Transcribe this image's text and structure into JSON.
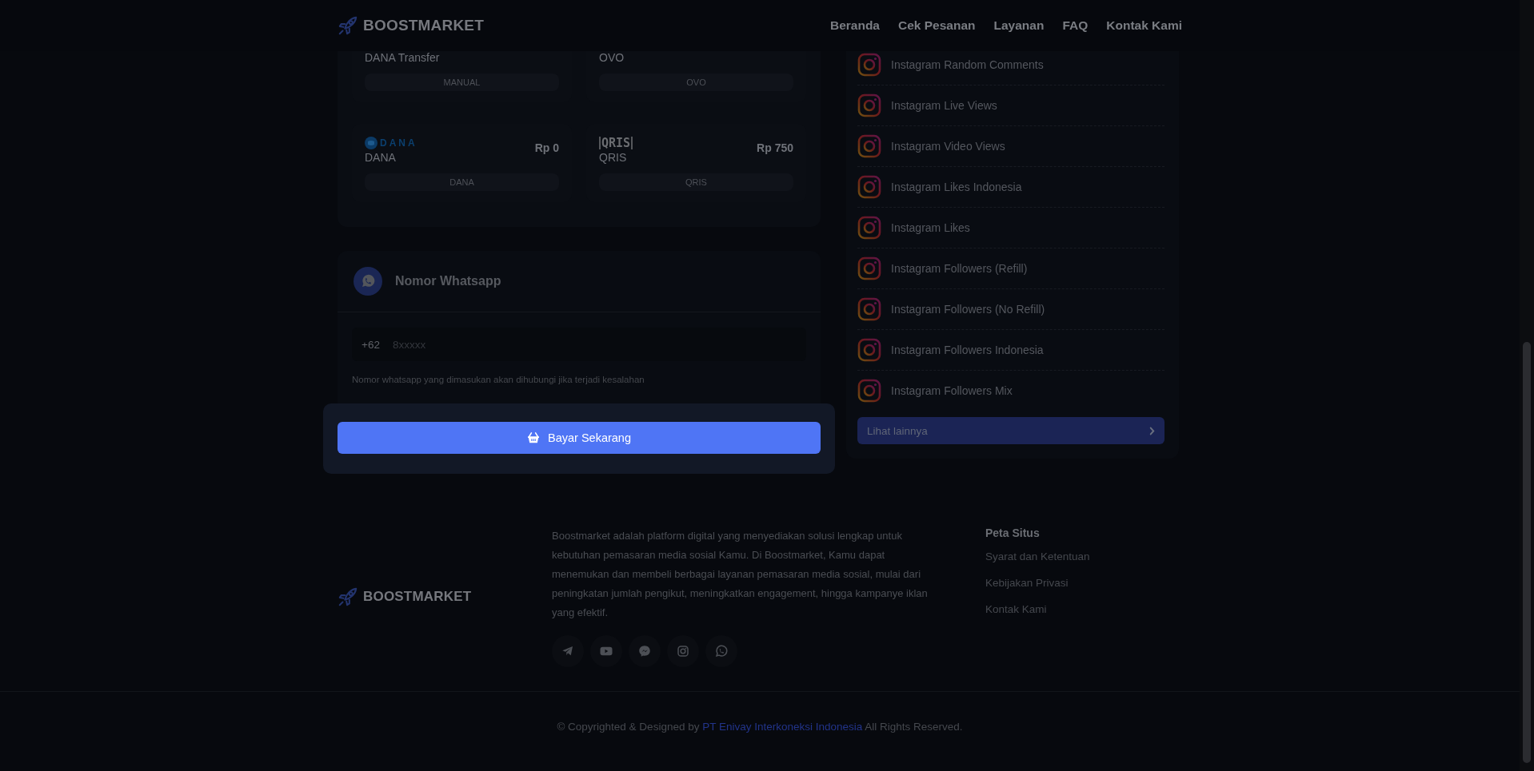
{
  "header": {
    "brand": "BOOSTMARKET",
    "nav": [
      {
        "label": "Beranda"
      },
      {
        "label": "Cek Pesanan"
      },
      {
        "label": "Layanan"
      },
      {
        "label": "FAQ"
      },
      {
        "label": "Kontak Kami"
      }
    ]
  },
  "payment_methods": [
    {
      "name": "DANA Transfer",
      "badge": "MANUAL"
    },
    {
      "name": "OVO",
      "badge": "OVO"
    },
    {
      "kind": "dana",
      "logo_text": "DANA",
      "price": "Rp 0",
      "name": "DANA",
      "badge": "DANA"
    },
    {
      "kind": "qris",
      "logo_text": "QRIS",
      "price": "Rp 750",
      "name": "QRIS",
      "badge": "QRIS"
    }
  ],
  "whatsapp": {
    "title": "Nomor Whatsapp",
    "prefix": "+62",
    "placeholder": "8xxxxx",
    "hint": "Nomor whatsapp yang dimasukan akan dihubungi jika terjadi kesalahan"
  },
  "pay_button": {
    "label": "Bayar Sekarang"
  },
  "services": [
    {
      "label": "Instagram Random Comments"
    },
    {
      "label": "Instagram Live Views"
    },
    {
      "label": "Instagram Video Views"
    },
    {
      "label": "Instagram Likes Indonesia"
    },
    {
      "label": "Instagram Likes"
    },
    {
      "label": "Instagram Followers (Refill)"
    },
    {
      "label": "Instagram Followers (No Refill)"
    },
    {
      "label": "Instagram Followers Indonesia"
    },
    {
      "label": "Instagram Followers Mix"
    }
  ],
  "more_button": {
    "label": "Lihat lainnya"
  },
  "footer": {
    "brand": "BOOSTMARKET",
    "about": "Boostmarket adalah platform digital yang menyediakan solusi lengkap untuk kebutuhan pemasaran media sosial Kamu. Di Boostmarket, Kamu dapat menemukan dan membeli berbagai layanan pemasaran media sosial, mulai dari peningkatan jumlah pengikut, meningkatkan engagement, hingga kampanye iklan yang efektif.",
    "sitemap_title": "Peta Situs",
    "sitemap": [
      {
        "label": "Syarat dan Ketentuan"
      },
      {
        "label": "Kebijakan Privasi"
      },
      {
        "label": "Kontak Kami"
      }
    ],
    "copyright": {
      "before": "© Copyrighted & Designed by",
      "link": "PT Enivay Interkoneksi Indonesia",
      "after": "All Rights Reserved."
    }
  }
}
